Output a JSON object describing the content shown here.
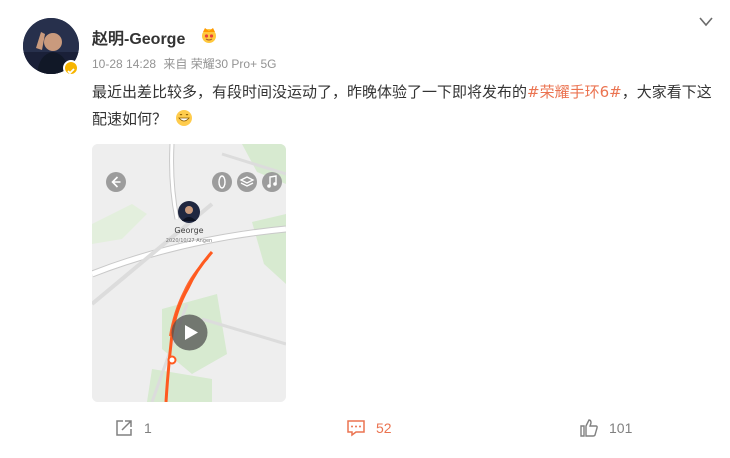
{
  "post": {
    "username": "赵明-George",
    "time": "10-28 14:28",
    "source": "来自 荣耀30 Pro+ 5G",
    "text_before": "最近出差比较多，有段时间没运动了，昨晚体验了一下即将发布的",
    "hashtag": "#荣耀手环6#",
    "text_after": "，大家看下这配速如何？",
    "emoji": "grinning-face-emoji"
  },
  "media": {
    "profile_name": "George",
    "date_label": "2020/10/27 Angen",
    "icons": [
      "back-icon",
      "compass-icon",
      "layers-icon",
      "music-icon",
      "play-icon"
    ]
  },
  "actions": {
    "share_count": "1",
    "comment_count": "52",
    "like_count": "101"
  },
  "colors": {
    "accent": "#eb7350",
    "meta": "#939393",
    "route": "#ff5a1f",
    "verified": "#f7b500"
  }
}
